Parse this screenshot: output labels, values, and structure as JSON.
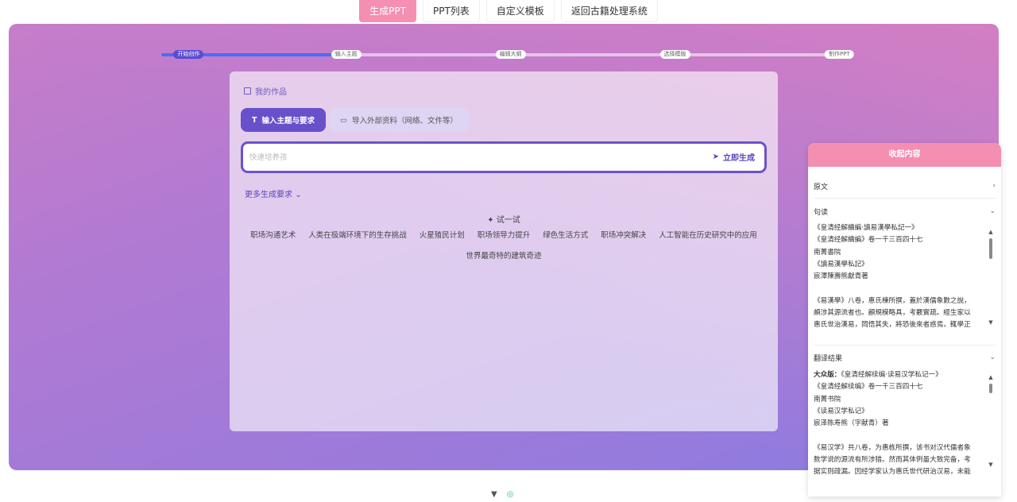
{
  "top_tabs": [
    {
      "label": "生成PPT",
      "active": true
    },
    {
      "label": "PPT列表",
      "active": false
    },
    {
      "label": "自定义模板",
      "active": false
    },
    {
      "label": "返回古籍处理系统",
      "active": false
    }
  ],
  "progress": {
    "steps": [
      "开始创作",
      "输入主题",
      "编辑大纲",
      "选择模版",
      "制作PPT"
    ],
    "completed_fraction": 0.25
  },
  "panel": {
    "my_works": "我的作品",
    "mode_tabs": {
      "topic": "输入主题与要求",
      "import": "导入外部资料（网络、文件等）"
    },
    "search": {
      "placeholder": "快速培养孩",
      "submit": "立即生成"
    },
    "more_requirements": "更多生成要求",
    "try_label": "试一试",
    "suggestions": [
      "职场沟通艺术",
      "人类在极端环境下的生存挑战",
      "火星殖民计划",
      "职场领导力提升",
      "绿色生活方式",
      "职场冲突解决",
      "人工智能在历史研究中的应用",
      "世界最奇特的建筑奇迹"
    ]
  },
  "drawer": {
    "header": "收起内容",
    "sections": {
      "original": "原文",
      "punctuated": "句读",
      "translation": "翻译结果"
    },
    "punctuated_text": "《皇清经解續編·讀易漢學私記一》\n《皇清经解續編》卷一千三百四十七\n南菁書院\n《讀易漢學私記》\n宸澤陳壽熊獻青著\n\n《易漢學》八卷，惠氏棟所撰，蓋於漢儒象數之說，\n頗涉其源流者也。顧規模略具，考覈實疏。經生家以\n惠氏世治漢易，岡悟其失，將恐後來者惑焉，輒學正",
    "translation_label": "大众版：",
    "translation_text": "《皇清经解续编·读易汉学私记一》\n《皇清经解续编》卷一千三百四十七\n南菁书院\n《读易汉学私记》\n宸泽陈寿熊（字献青）著\n\n《易汉学》共八卷，为惠栋所撰，该书对汉代儒者象\n数学说的源流有所涉猎。然而其体例虽大致完备，考\n据实则疏漏。因经学家认为惠氏世代研治汉易，未能"
  }
}
